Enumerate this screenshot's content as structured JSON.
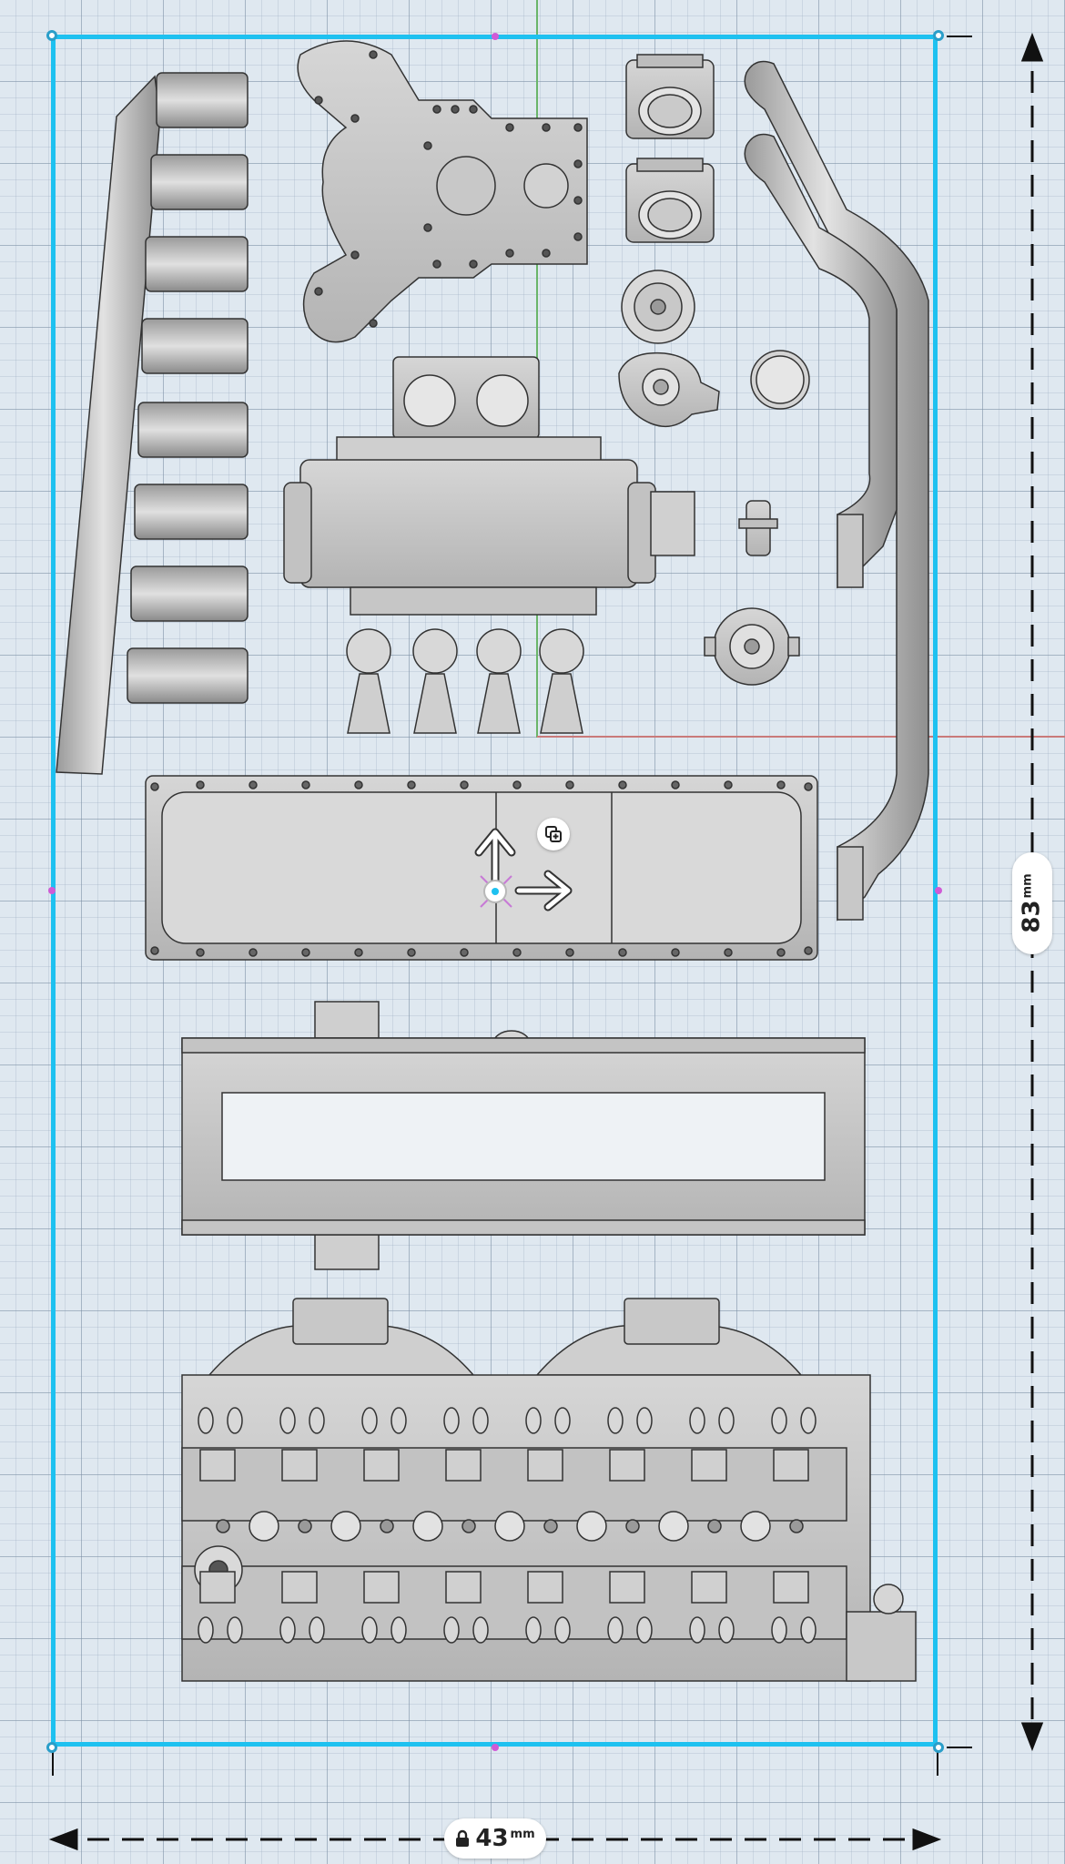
{
  "viewport": {
    "grid_visible": true,
    "axis_colors": {
      "y_axis": "#6ab56a",
      "x_axis": "#c97a7a"
    },
    "selection_color": "#1ec1f0"
  },
  "selection": {
    "width_value": "43",
    "width_unit": "mm",
    "width_locked": true,
    "height_value": "83",
    "height_unit": "mm"
  },
  "gizmo": {
    "move_y_icon": "arrow-up-icon",
    "move_x_icon": "arrow-right-icon",
    "duplicate_icon": "duplicate-icon",
    "pivot_icon": "pivot-point-icon"
  },
  "parts": [
    {
      "name": "intake-runner-rail"
    },
    {
      "name": "timing-cover"
    },
    {
      "name": "throttle-body-1"
    },
    {
      "name": "throttle-body-2"
    },
    {
      "name": "exhaust-headers"
    },
    {
      "name": "pulley"
    },
    {
      "name": "water-pump"
    },
    {
      "name": "oil-filter-cap"
    },
    {
      "name": "supercharger"
    },
    {
      "name": "fuel-filter"
    },
    {
      "name": "alternator"
    },
    {
      "name": "oil-pan"
    },
    {
      "name": "intake-plenum-frame"
    },
    {
      "name": "cylinder-head-block"
    }
  ]
}
